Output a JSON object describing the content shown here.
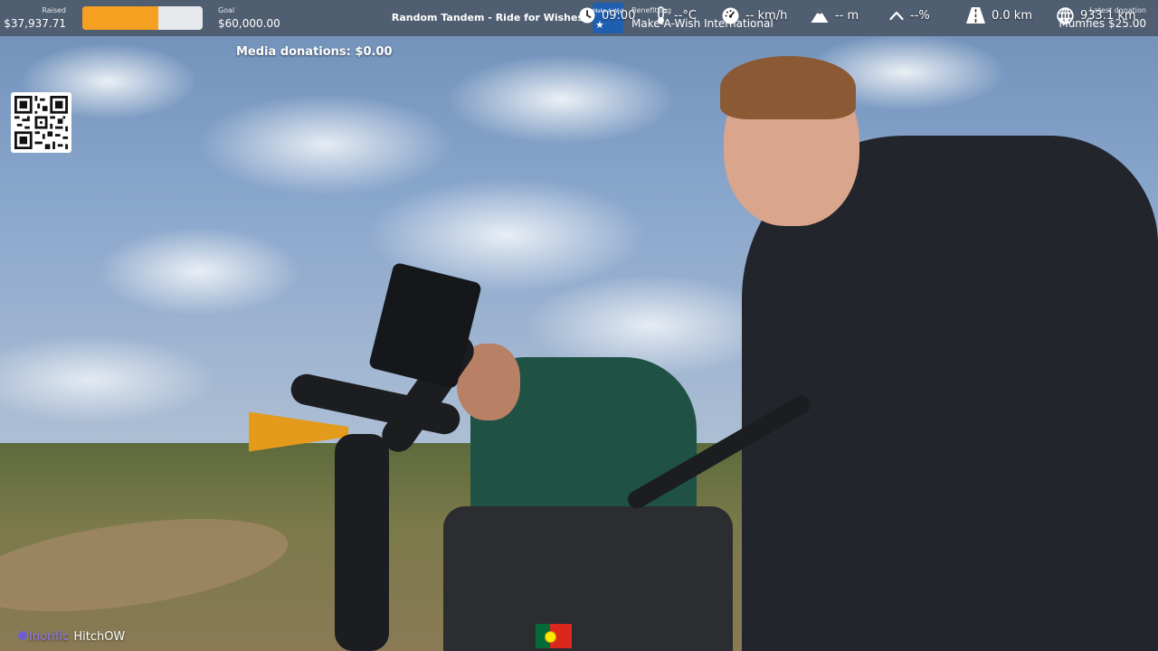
{
  "topbar": {
    "raised_label": "Raised",
    "raised_value": "$37,937.71",
    "progress_fraction": 0.632,
    "progress_color": "#f5a020",
    "goal_label": "Goal",
    "goal_value": "$60,000.00",
    "event_title": "Random Tandem - Ride for Wishes",
    "charity_logo_text": "Make-A-Wish",
    "benefitting_label": "Benefitting",
    "benefitting_value": "Make-A-Wish International",
    "latest_label": "Latest donation",
    "latest_value": "Mumfies $25.00"
  },
  "overlay": {
    "media_donations": "Media donations: $0.00",
    "qr_icon": "qr-code-icon"
  },
  "bottombar": {
    "channel_name": "Inorific",
    "channel_user": "HitchOW",
    "country_flag": "portugal-flag-icon",
    "time": "09:00",
    "temperature": "--°C",
    "speed": "-- km/h",
    "altitude": "-- m",
    "incline": "--%",
    "distance": "0.0 km",
    "total_distance": "933.1 km"
  }
}
